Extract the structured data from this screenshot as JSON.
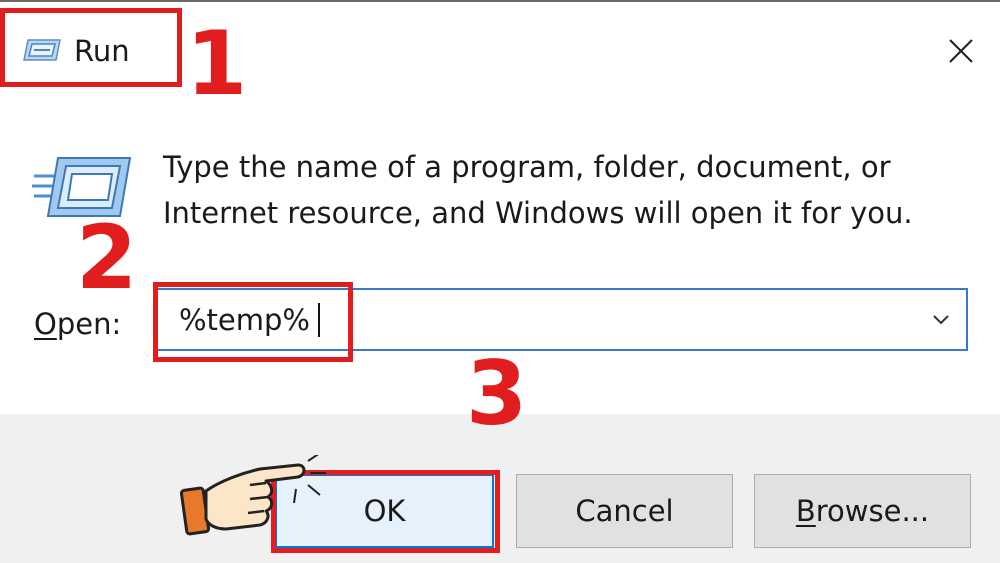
{
  "window": {
    "title": "Run",
    "close_symbol": "✕",
    "description": "Type the name of a program, folder, document, or Internet resource, and Windows will open it for you."
  },
  "open_field": {
    "label_mnemonic": "O",
    "label_rest": "pen:",
    "value": "%temp%"
  },
  "buttons": {
    "ok": "OK",
    "cancel": "Cancel",
    "browse_mnemonic": "B",
    "browse_rest": "rowse..."
  },
  "annotations": {
    "step1": "1",
    "step2": "2",
    "step3": "3",
    "highlight_color": "#e21d1d"
  },
  "icons": [
    "run-icon",
    "close-icon",
    "run-app-icon",
    "chevron-down-icon",
    "pointing-hand-icon"
  ]
}
